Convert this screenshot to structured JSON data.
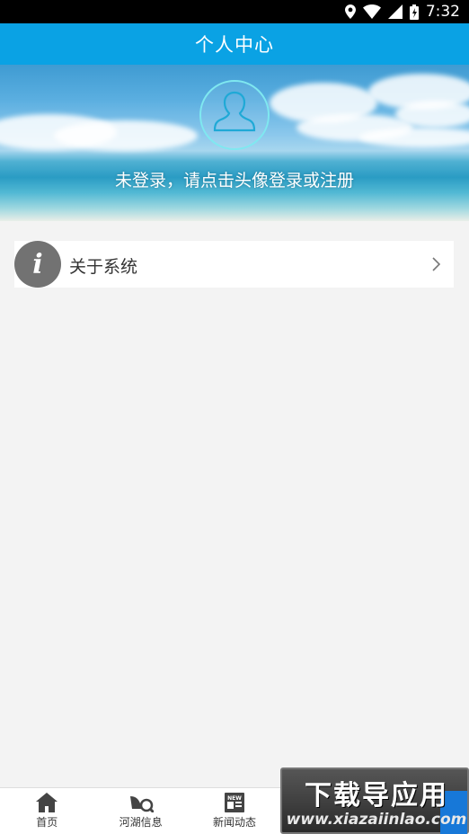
{
  "status_bar": {
    "time": "7:32",
    "icons": [
      "location-icon",
      "wifi-icon",
      "signal-icon",
      "battery-icon"
    ]
  },
  "header": {
    "title": "个人中心",
    "color": "#0aa2e4"
  },
  "banner": {
    "avatar_icon": "user-avatar-icon",
    "login_hint": "未登录，请点击头像登录或注册"
  },
  "menu": {
    "items": [
      {
        "icon": "info-icon",
        "icon_glyph": "i",
        "label": "关于系统",
        "chevron": "chevron-right-icon"
      }
    ]
  },
  "bottom_nav": {
    "items": [
      {
        "icon": "home-icon",
        "label": "首页"
      },
      {
        "icon": "river-icon",
        "label": "河湖信息"
      },
      {
        "icon": "news-icon",
        "label": "新闻动态",
        "badge": "NEW"
      },
      {
        "icon": "nav-icon-4",
        "label": ""
      },
      {
        "icon": "nav-icon-5",
        "label": ""
      }
    ]
  },
  "watermark": {
    "title": "下载导应用",
    "url": "www.xiazaiinlao.com"
  }
}
